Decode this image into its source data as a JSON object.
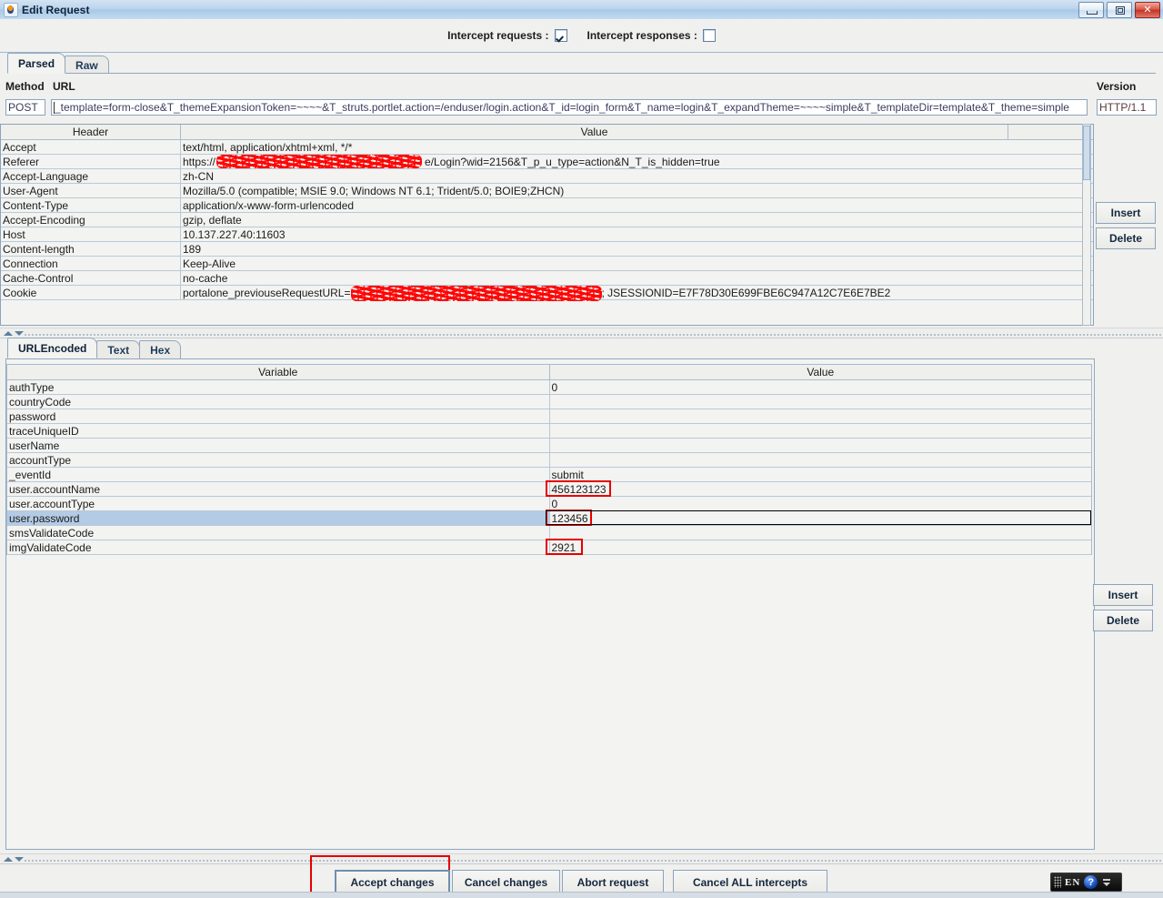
{
  "window": {
    "title": "Edit Request",
    "icon": "java-coffee-cup-icon",
    "minimize_label": "—",
    "maximize_label": "□",
    "close_label": "✕"
  },
  "intercept": {
    "requests_label": "Intercept requests :",
    "requests_checked": true,
    "responses_label": "Intercept responses :",
    "responses_checked": false
  },
  "top_tabs": [
    {
      "label": "Parsed",
      "selected": true
    },
    {
      "label": "Raw",
      "selected": false
    }
  ],
  "request_line": {
    "method_label": "Method",
    "url_label": "URL",
    "version_label": "Version",
    "method_value": "POST",
    "url_value": "_template=form-close&T_themeExpansionToken=~~~~&T_struts.portlet.action=/enduser/login.action&T_id=login_form&T_name=login&T_expandTheme=~~~~simple&T_templateDir=template&T_theme=simple",
    "version_value": "HTTP/1.1"
  },
  "headers_table": {
    "columns": [
      "Header",
      "Value"
    ],
    "rows": [
      {
        "header": "Accept",
        "value": "text/html, application/xhtml+xml, */*",
        "redacted": false
      },
      {
        "header": "Referer",
        "value": "https://",
        "value_tail": "e/Login?wid=2156&T_p_u_type=action&N_T_is_hidden=true",
        "redacted": true
      },
      {
        "header": "Accept-Language",
        "value": "zh-CN",
        "redacted": false
      },
      {
        "header": "User-Agent",
        "value": "Mozilla/5.0 (compatible; MSIE 9.0; Windows NT 6.1; Trident/5.0; BOIE9;ZHCN)",
        "redacted": false
      },
      {
        "header": "Content-Type",
        "value": "application/x-www-form-urlencoded",
        "redacted": false
      },
      {
        "header": "Accept-Encoding",
        "value": "gzip, deflate",
        "redacted": false
      },
      {
        "header": "Host",
        "value": "10.137.227.40:11603",
        "redacted": false
      },
      {
        "header": "Content-length",
        "value": "189",
        "redacted": false
      },
      {
        "header": "Connection",
        "value": "Keep-Alive",
        "redacted": false
      },
      {
        "header": "Cache-Control",
        "value": "no-cache",
        "redacted": false
      },
      {
        "header": "Cookie",
        "value": "portalone_previouseRequestURL=",
        "value_tail": "; JSESSIONID=E7F78D30E699FBE6C947A12C7E6E7BE2",
        "redacted": true
      }
    ]
  },
  "headers_side_buttons": {
    "insert_label": "Insert",
    "delete_label": "Delete"
  },
  "body_tabs": [
    {
      "label": "URLEncoded",
      "selected": true
    },
    {
      "label": "Text",
      "selected": false
    },
    {
      "label": "Hex",
      "selected": false
    }
  ],
  "body_table": {
    "columns": [
      "Variable",
      "Value"
    ],
    "rows": [
      {
        "variable": "authType",
        "value": "0",
        "selected": false,
        "highlight": false
      },
      {
        "variable": "countryCode",
        "value": "",
        "selected": false,
        "highlight": false
      },
      {
        "variable": "password",
        "value": "",
        "selected": false,
        "highlight": false
      },
      {
        "variable": "traceUniqueID",
        "value": "",
        "selected": false,
        "highlight": false
      },
      {
        "variable": "userName",
        "value": "",
        "selected": false,
        "highlight": false
      },
      {
        "variable": "accountType",
        "value": "",
        "selected": false,
        "highlight": false
      },
      {
        "variable": "_eventId",
        "value": "submit",
        "selected": false,
        "highlight": false
      },
      {
        "variable": "user.accountName",
        "value": "456123123",
        "selected": false,
        "highlight": true
      },
      {
        "variable": "user.accountType",
        "value": "0",
        "selected": false,
        "highlight": false
      },
      {
        "variable": "user.password",
        "value": "123456",
        "selected": true,
        "highlight": true
      },
      {
        "variable": "smsValidateCode",
        "value": "",
        "selected": false,
        "highlight": false
      },
      {
        "variable": "imgValidateCode",
        "value": "2921",
        "selected": false,
        "highlight": true
      }
    ]
  },
  "body_side_buttons": {
    "insert_label": "Insert",
    "delete_label": "Delete"
  },
  "action_buttons": [
    {
      "label": "Accept changes",
      "focused": true,
      "highlighted": true
    },
    {
      "label": "Cancel changes",
      "focused": false,
      "highlighted": false
    },
    {
      "label": "Abort request",
      "focused": false,
      "highlighted": false
    },
    {
      "label": "Cancel ALL intercepts",
      "focused": false,
      "highlighted": false
    }
  ],
  "ime": {
    "language": "EN",
    "help_label": "?"
  },
  "highlight_color": "#e50000",
  "selection_color": "#b3cbe4"
}
